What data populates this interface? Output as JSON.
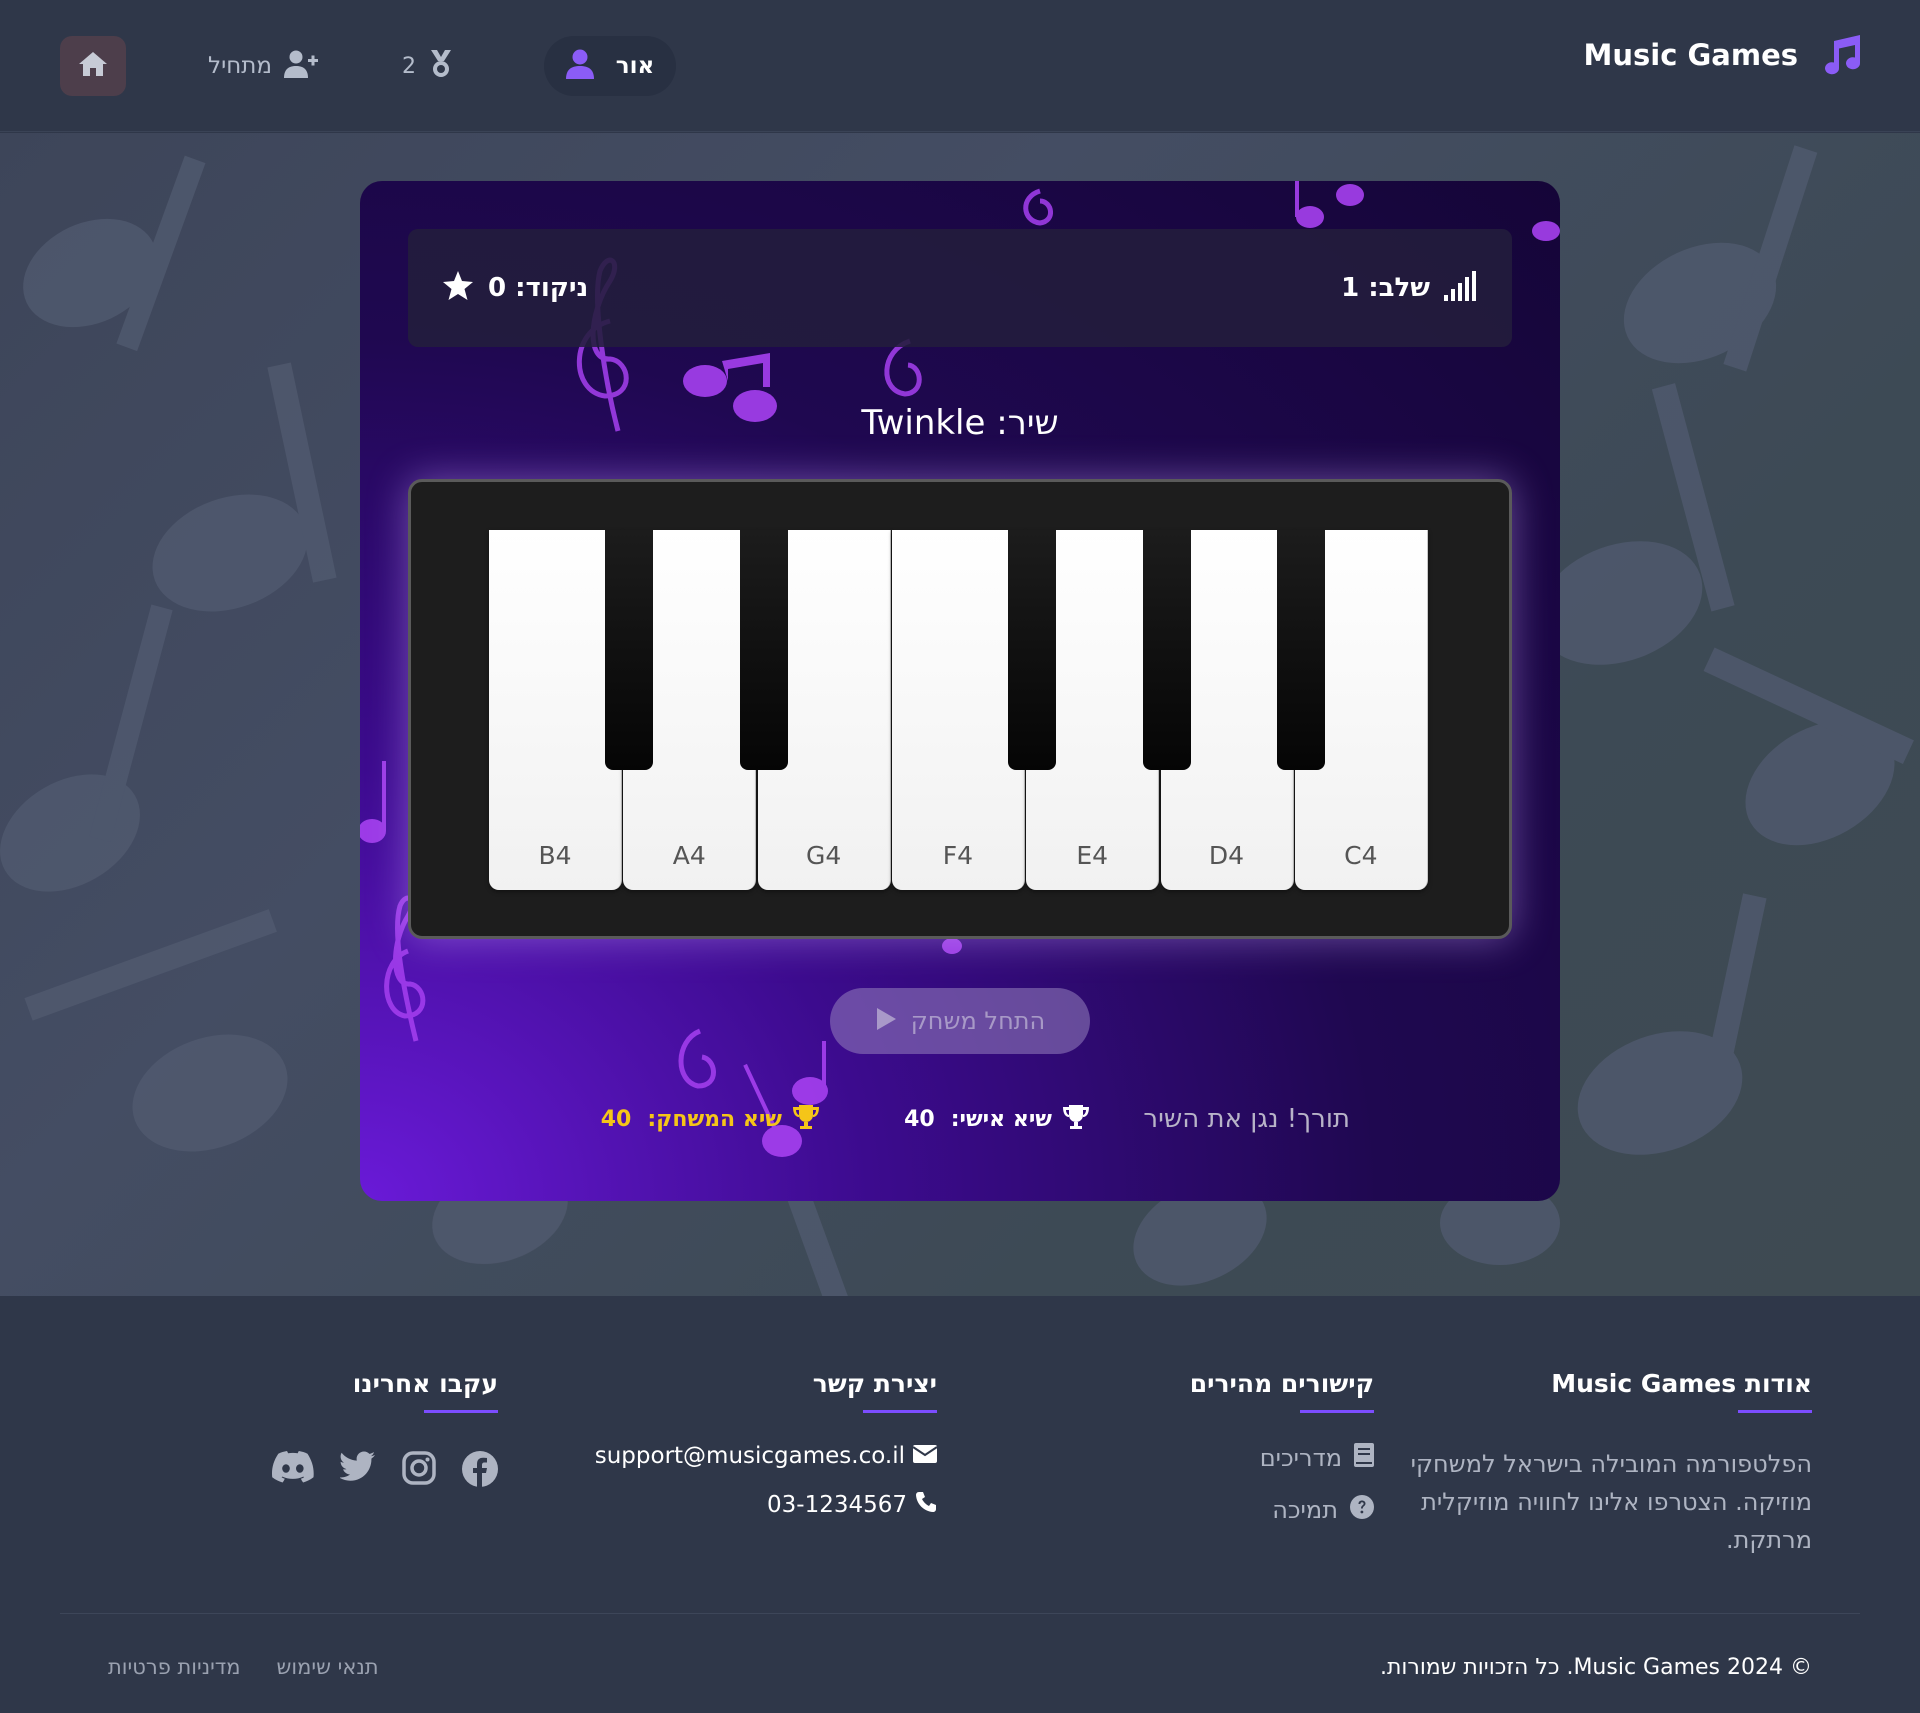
{
  "header": {
    "brand": "Music Games",
    "user_name": "אור",
    "medals_count": "2",
    "level_label": "מתחיל"
  },
  "game": {
    "level_text": "שלב: 1",
    "score_text": "ניקוד: 0",
    "song_title": "שיר: Twinkle",
    "keys": [
      "B4",
      "A4",
      "G4",
      "F4",
      "E4",
      "D4",
      "C4"
    ],
    "start_label": "התחל משחק",
    "hint": "תורך! נגן את השיר",
    "personal_record_label": "שיא אישי:",
    "personal_record_value": "40",
    "game_record_label": "שיא המשחק:",
    "game_record_value": "40"
  },
  "footer": {
    "about_title": "אודות Music Games",
    "about_text": "הפלטפורמה המובילה בישראל למשחקי מוזיקה. הצטרפו אלינו לחוויה מוזיקלית מרתקת.",
    "links_title": "קישורים מהירים",
    "link_guides": "מדריכים",
    "link_support": "תמיכה",
    "contact_title": "יצירת קשר",
    "email": "support@musicgames.co.il",
    "phone": "03-1234567",
    "follow_title": "עקבו אחרינו",
    "copyright": "© 2024 Music Games. כל הזכויות שמורות.",
    "terms": "תנאי שימוש",
    "privacy": "מדיניות פרטיות"
  },
  "colors": {
    "accent": "#7c4dff",
    "record_gold": "#f5c518",
    "card_purple": "#3c0b8e",
    "header_bg": "#2f3749"
  },
  "icons": [
    "music-note-icon",
    "user-icon",
    "medal-icon",
    "user-plus-icon",
    "home-icon",
    "signal-bars-icon",
    "star-icon",
    "play-icon",
    "trophy-icon",
    "book-icon",
    "question-circle-icon",
    "envelope-icon",
    "phone-icon",
    "facebook-icon",
    "instagram-icon",
    "twitter-icon",
    "discord-icon"
  ]
}
